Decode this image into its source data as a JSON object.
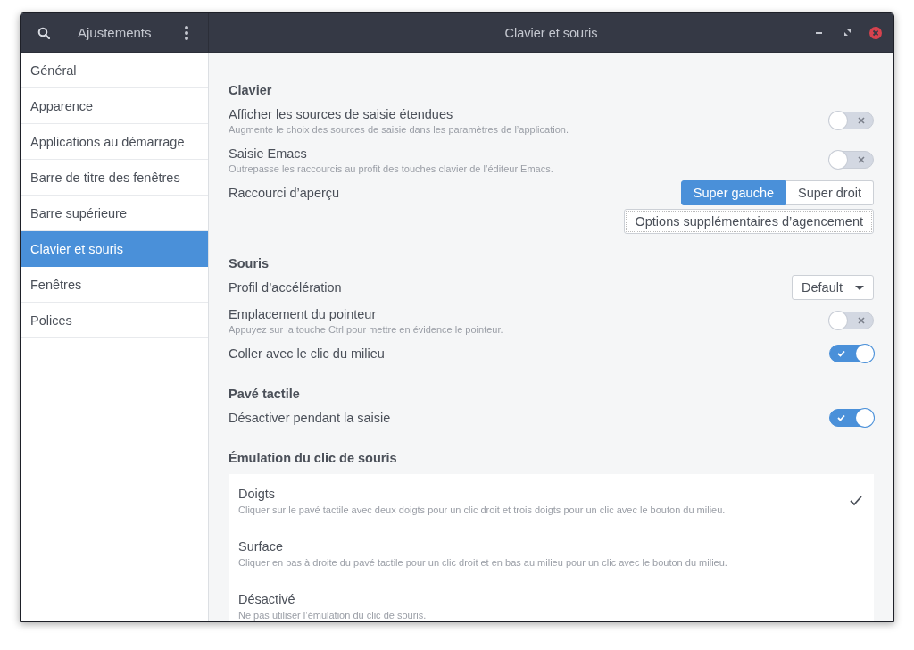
{
  "header": {
    "app_title": "Ajustements",
    "window_title": "Clavier et souris"
  },
  "sidebar": {
    "items": [
      {
        "label": "Général",
        "selected": false
      },
      {
        "label": "Apparence",
        "selected": false
      },
      {
        "label": "Applications au démarrage",
        "selected": false
      },
      {
        "label": "Barre de titre des fenêtres",
        "selected": false
      },
      {
        "label": "Barre supérieure",
        "selected": false
      },
      {
        "label": "Clavier et souris",
        "selected": true
      },
      {
        "label": "Fenêtres",
        "selected": false
      },
      {
        "label": "Polices",
        "selected": false
      }
    ]
  },
  "sections": [
    {
      "title": "Clavier",
      "rows": [
        {
          "kind": "switch",
          "label": "Afficher les sources de saisie étendues",
          "description": "Augmente le choix des sources de saisie dans les paramètres de l’application.",
          "on": false
        },
        {
          "kind": "switch",
          "label": "Saisie Emacs",
          "description": "Outrepasse les raccourcis au profit des touches clavier de l’éditeur Emacs.",
          "on": false
        },
        {
          "kind": "segmented",
          "label": "Raccourci d’aperçu",
          "options": [
            {
              "label": "Super gauche",
              "selected": true
            },
            {
              "label": "Super droit",
              "selected": false
            }
          ]
        },
        {
          "kind": "button",
          "label": "Options supplémentaires d’agencement"
        }
      ]
    },
    {
      "title": "Souris",
      "rows": [
        {
          "kind": "dropdown",
          "label": "Profil d’accélération",
          "value": "Default"
        },
        {
          "kind": "switch",
          "label": "Emplacement du pointeur",
          "description": "Appuyez sur la touche Ctrl pour mettre en évidence le pointeur.",
          "on": false
        },
        {
          "kind": "switch",
          "label": "Coller avec le clic du milieu",
          "on": true
        }
      ]
    },
    {
      "title": "Pavé tactile",
      "rows": [
        {
          "kind": "switch",
          "label": "Désactiver pendant la saisie",
          "on": true
        }
      ]
    },
    {
      "title": "Émulation du clic de souris",
      "rows": [
        {
          "kind": "choices",
          "options": [
            {
              "label": "Doigts",
              "description": "Cliquer sur le pavé tactile avec deux doigts pour un clic droit et trois doigts pour un clic avec le bouton du milieu.",
              "selected": true
            },
            {
              "label": "Surface",
              "description": "Cliquer en bas à droite du pavé tactile pour un clic droit et en bas au milieu pour un clic avec le bouton du milieu.",
              "selected": false
            },
            {
              "label": "Désactivé",
              "description": "Ne pas utiliser l’émulation du clic de souris.",
              "selected": false
            }
          ]
        }
      ]
    }
  ]
}
